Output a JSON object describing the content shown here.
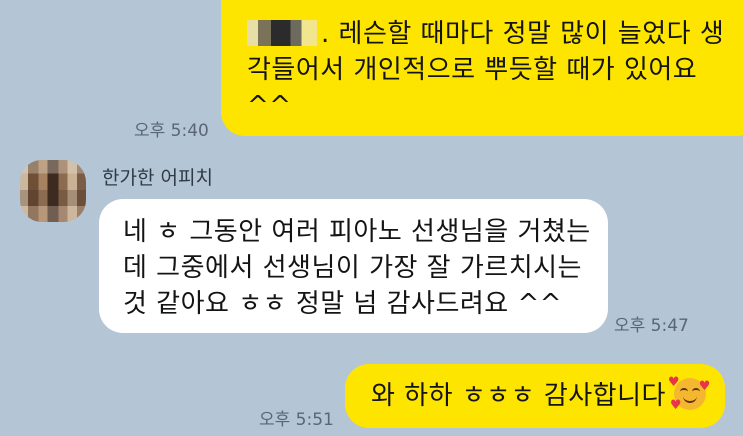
{
  "messages": [
    {
      "lines": [
        ". 레슨할 때마다 정말 많이 늘었다 생",
        "각들어서 개인적으로 뿌듯할 때가 있어요",
        "^^"
      ],
      "time": "오후 5:40"
    },
    {
      "sender": "한가한 어피치",
      "lines": [
        "네 ㅎ 그동안 여러 피아노 선생님을 거쳤는",
        "데  그중에서 선생님이 가장 잘 가르치시는",
        "것 같아요 ㅎㅎ 정말 넘 감사드려요 ^^"
      ],
      "time": "오후 5:47"
    },
    {
      "text": "와 하하 ㅎㅎㅎ 감사합니다",
      "emoji": "smiling-face-with-hearts-icon",
      "time": "오후 5:51"
    }
  ],
  "colors": {
    "background": "#b4c5d6",
    "my_bubble": "#fee500",
    "their_bubble": "#ffffff"
  }
}
